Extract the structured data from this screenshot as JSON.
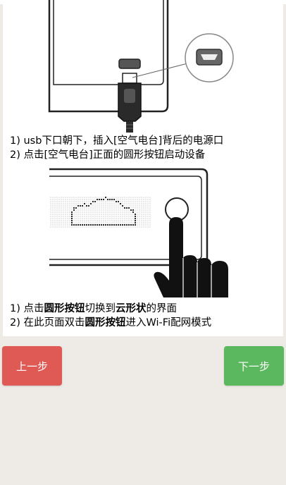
{
  "instructions": {
    "step_a": {
      "line1": "1) usb下口朝下，插入[空气电台]背后的电源口",
      "line2": "2) 点击[空气电台]正面的圆形按钮启动设备"
    },
    "step_b": {
      "line1_prefix": "1) 点击",
      "line1_bold1": "圆形按钮",
      "line1_mid": "切换到",
      "line1_bold2": "云形状",
      "line1_suffix": "的界面",
      "line2_prefix": "2) 在此页面双击",
      "line2_bold": "圆形按钮",
      "line2_suffix": "进入Wi-Fi配网模式"
    }
  },
  "buttons": {
    "prev_label": "上一步",
    "next_label": "下一步"
  },
  "colors": {
    "prev_button": "#e05a55",
    "next_button": "#5cb85f",
    "page_background": "#eeebe6"
  },
  "icons": {
    "usb_plug": "usb-plug-illustration",
    "micro_usb_port": "micro-usb-port-icon",
    "hand": "finger-press-illustration"
  }
}
